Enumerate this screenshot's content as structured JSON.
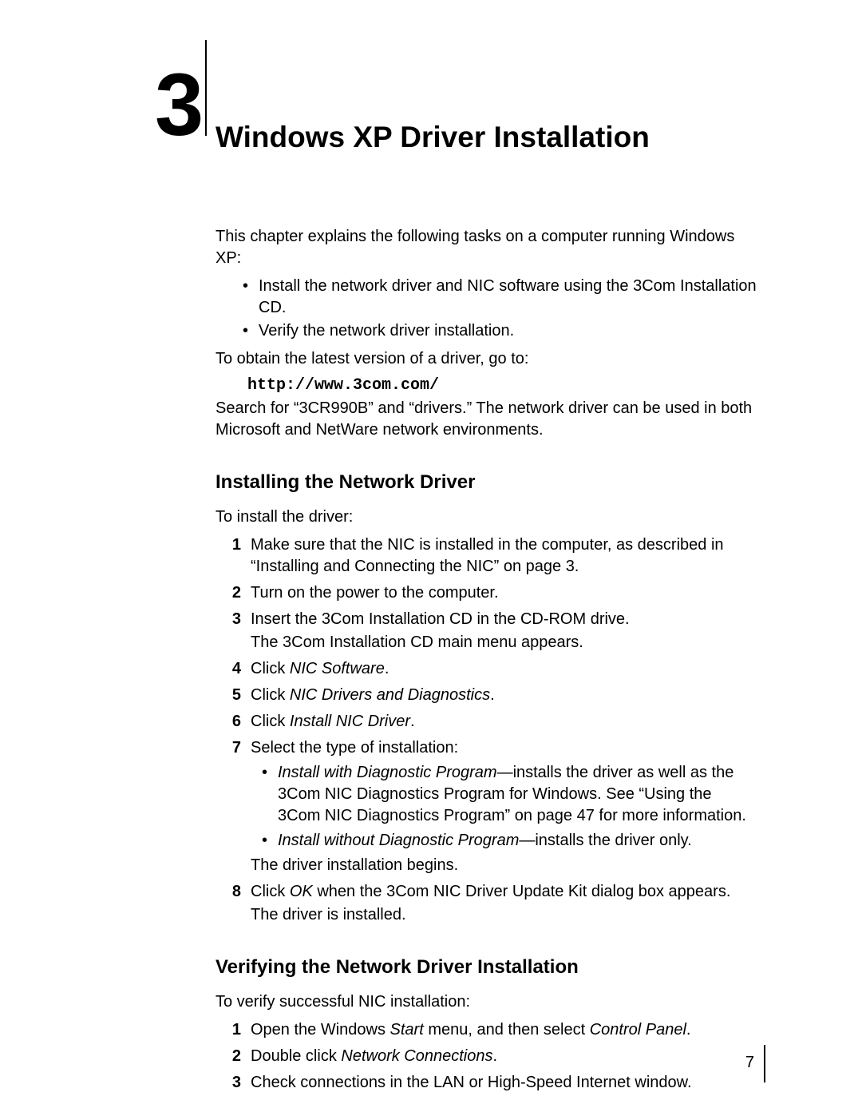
{
  "chapter": {
    "number": "3",
    "title": "Windows XP Driver Installation"
  },
  "intro": {
    "lead": "This chapter explains the following tasks on a computer running Windows XP:",
    "bullets": [
      "Install the network driver and NIC software using the 3Com Installation CD.",
      "Verify the network driver installation."
    ],
    "obtain": "To obtain the latest version of a driver, go to:",
    "url": "http://www.3com.com/",
    "search": "Search for “3CR990B” and “drivers.” The network driver can be used in both Microsoft and NetWare network environments."
  },
  "section1": {
    "heading": "Installing the Network Driver",
    "lead": "To install the driver:",
    "steps": {
      "s1": "Make sure that the NIC is installed in the computer, as described in “Installing and Connecting the NIC” on page 3.",
      "s2": "Turn on the power to the computer.",
      "s3a": "Insert the 3Com Installation CD in the CD-ROM drive.",
      "s3b": "The 3Com Installation CD main menu appears.",
      "s4_pre": "Click ",
      "s4_it": "NIC Software",
      "s4_post": ".",
      "s5_pre": "Click ",
      "s5_it": "NIC Drivers and Diagnostics",
      "s5_post": ".",
      "s6_pre": "Click ",
      "s6_it": "Install NIC Driver",
      "s6_post": ".",
      "s7_lead": "Select the type of installation:",
      "s7_b1_it": "Install with Diagnostic Program",
      "s7_b1_rest": "—installs the driver as well as the 3Com NIC Diagnostics Program for Windows. See “Using the 3Com NIC Diagnostics Program” on page 47 for more information.",
      "s7_b2_it": "Install without Diagnostic Program",
      "s7_b2_rest": "—installs the driver only.",
      "s7_end": "The driver installation begins.",
      "s8_pre": "Click ",
      "s8_it": "OK",
      "s8_post": " when the 3Com NIC Driver Update Kit dialog box appears.",
      "s8_end": "The driver is installed."
    }
  },
  "section2": {
    "heading": "Verifying the Network Driver Installation",
    "lead": "To verify successful NIC installation:",
    "steps": {
      "s1_pre": "Open the Windows ",
      "s1_it1": "Start",
      "s1_mid": " menu, and then select ",
      "s1_it2": "Control Panel",
      "s1_post": ".",
      "s2_pre": "Double click ",
      "s2_it": "Network Connections",
      "s2_post": ".",
      "s3": "Check connections in the LAN or High-Speed Internet window."
    }
  },
  "page_number": "7"
}
